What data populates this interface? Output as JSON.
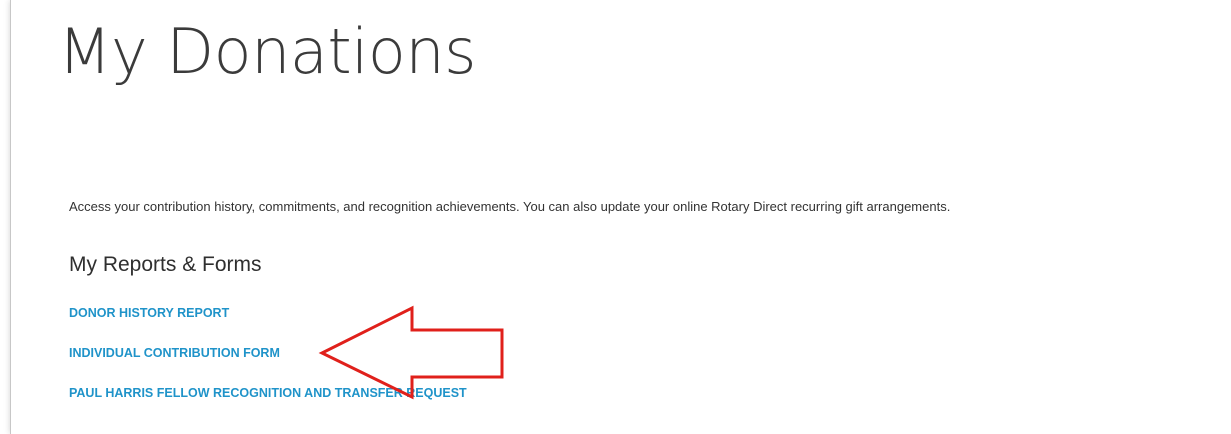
{
  "page": {
    "title": "My Donations",
    "intro": "Access your contribution history, commitments, and recognition achievements. You can also update your online Rotary Direct recurring gift arrangements."
  },
  "reports": {
    "heading": "My Reports & Forms",
    "links": [
      {
        "label": "DONOR HISTORY REPORT"
      },
      {
        "label": "INDIVIDUAL CONTRIBUTION FORM"
      },
      {
        "label": "PAUL HARRIS FELLOW RECOGNITION AND TRANSFER REQUEST"
      }
    ]
  },
  "annotation": {
    "arrow_color": "#e0201b",
    "arrow_target": "INDIVIDUAL CONTRIBUTION FORM"
  },
  "colors": {
    "link": "#1f93c9",
    "title": "#3b3b3b",
    "text": "#333333"
  }
}
